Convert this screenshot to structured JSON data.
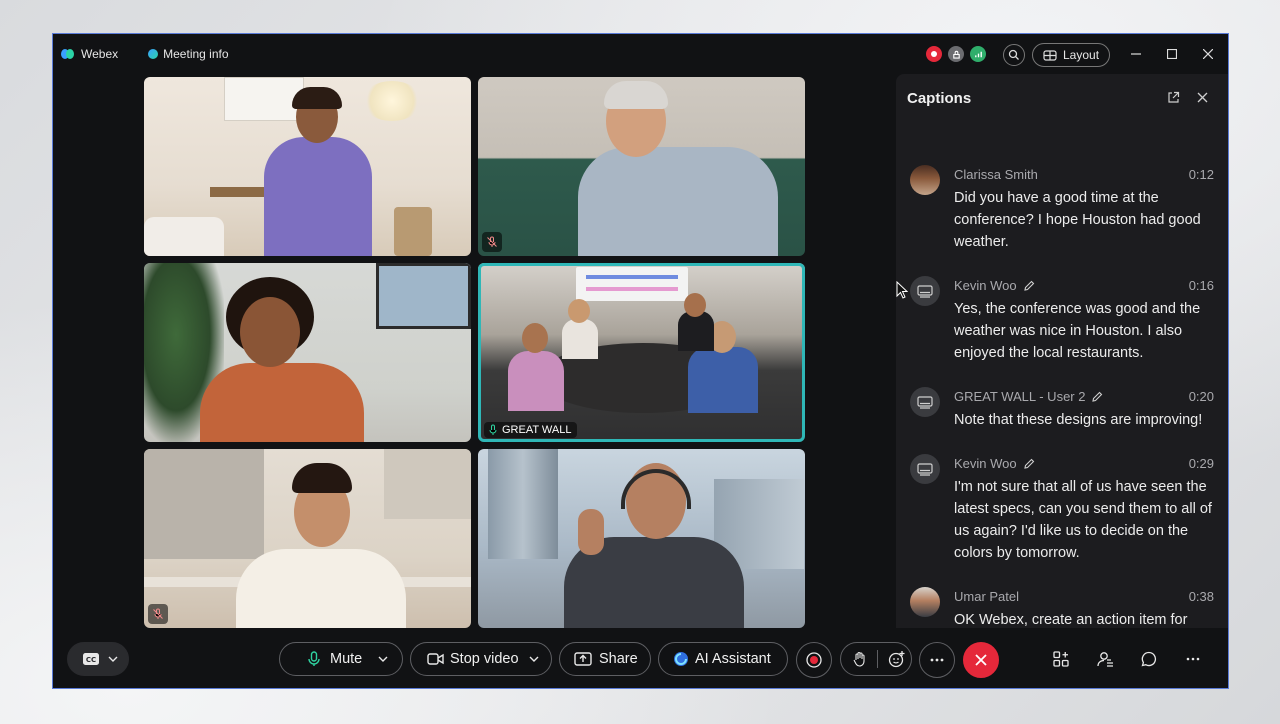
{
  "app": {
    "name": "Webex",
    "meeting_info_label": "Meeting info",
    "layout_label": "Layout"
  },
  "tiles": [
    {
      "id": "woman-purple",
      "muted": false
    },
    {
      "id": "older-man",
      "muted": true
    },
    {
      "id": "woman-orange",
      "muted": false
    },
    {
      "id": "great-wall",
      "label": "GREAT WALL",
      "active_speaker": true
    },
    {
      "id": "woman-kitchen",
      "muted": true
    },
    {
      "id": "man-headset",
      "muted": false
    }
  ],
  "captions": {
    "title": "Captions",
    "entries": [
      {
        "name": "Clarissa Smith",
        "time": "0:12",
        "text": "Did you have a good time at the conference? I hope Houston had good weather.",
        "avatar": "photo",
        "editable": false
      },
      {
        "name": "Kevin Woo",
        "time": "0:16",
        "text": "Yes, the conference was good and the weather was nice in Houston. I also enjoyed the local restaurants.",
        "avatar": "device",
        "editable": true
      },
      {
        "name": "GREAT WALL - User 2",
        "time": "0:20",
        "text": "Note that these designs are improving!",
        "avatar": "device",
        "editable": true
      },
      {
        "name": "Kevin Woo",
        "time": "0:29",
        "text": "I'm not sure that all of us have seen the latest specs, can you send them to all of us again? I'd like us to decide on the colors by tomorrow.",
        "avatar": "device",
        "editable": true
      },
      {
        "name": "Umar Patel",
        "time": "0:38",
        "text": "OK Webex, create an action item for Henry Riggs to send the specs to everyone.",
        "avatar": "photo",
        "editable": false
      }
    ]
  },
  "controls": {
    "mute_label": "Mute",
    "stop_video_label": "Stop video",
    "share_label": "Share",
    "ai_assistant_label": "AI Assistant"
  },
  "colors": {
    "accent_teal": "#2fb7b7",
    "end_call_red": "#e5283a",
    "window_bg": "#111214",
    "panel_bg": "#1c1c1f"
  }
}
